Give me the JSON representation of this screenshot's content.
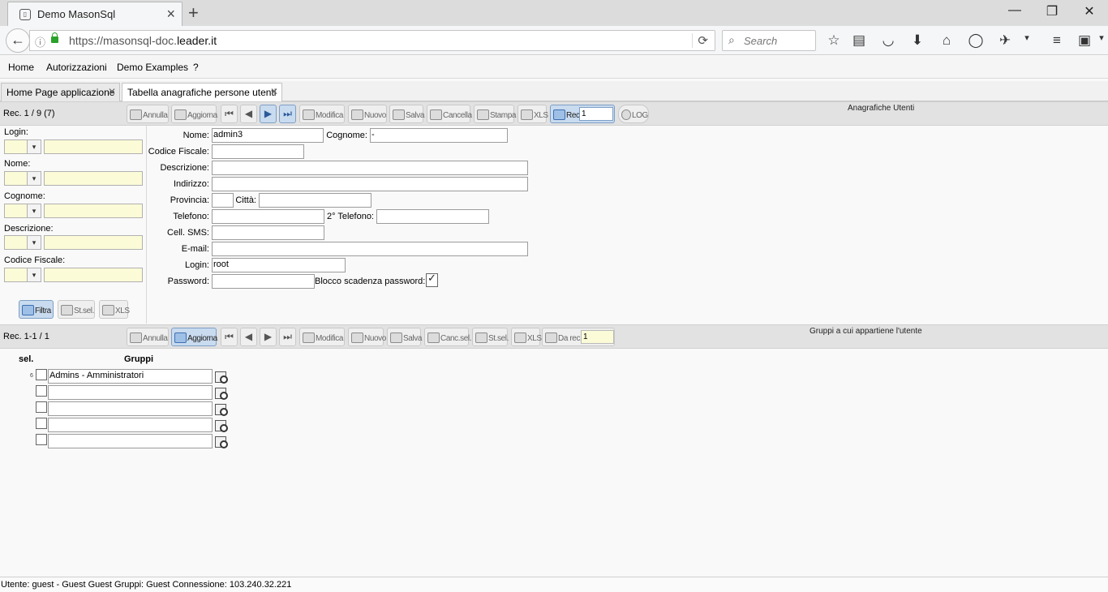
{
  "browser": {
    "tab_title": "Demo MasonSql",
    "favicon": "app-favicon",
    "close_icon": "close-icon",
    "new_tab_glyph": "+",
    "url_plain": "https://masonsql-doc.",
    "url_domain": "leader.it",
    "search_placeholder": "Search",
    "window_controls": [
      "minimize-icon",
      "restore-icon",
      "close-icon"
    ]
  },
  "menu": {
    "items": [
      "Home",
      "Autorizzazioni",
      "Demo Examples",
      "?"
    ]
  },
  "app_tabs": [
    {
      "label": "Home Page applicazione",
      "active": false
    },
    {
      "label": "Tabella anagrafiche persone utenti",
      "active": true
    }
  ],
  "toolbar1": {
    "record_info": "Rec. 1 / 9 (7)",
    "buttons": {
      "annulla": "Annulla",
      "aggiorna": "Aggiorna",
      "modifica": "Modifica",
      "nuovo": "Nuovo",
      "salva": "Salva",
      "cancella": "Cancella",
      "stampa": "Stampa",
      "xls": "XLS",
      "rec": "Rec.",
      "log": "LOG"
    },
    "rec_value": "1",
    "title": "Anagrafiche Utenti"
  },
  "filter": {
    "fields": [
      "Login:",
      "Nome:",
      "Cognome:",
      "Descrizione:",
      "Codice Fiscale:"
    ],
    "buttons": {
      "filtra": "Filtra",
      "stsel": "St.sel.",
      "xls": "XLS"
    }
  },
  "form": {
    "labels": {
      "nome": "Nome:",
      "cognome": "Cognome:",
      "codice_fiscale": "Codice Fiscale:",
      "descrizione": "Descrizione:",
      "indirizzo": "Indirizzo:",
      "provincia": "Provincia:",
      "citta": "Città:",
      "telefono": "Telefono:",
      "telefono2": "2° Telefono:",
      "cell_sms": "Cell. SMS:",
      "email": "E-mail:",
      "login": "Login:",
      "password": "Password:",
      "blocco": "Blocco scadenza password:"
    },
    "values": {
      "nome": "admin3",
      "cognome": "-",
      "codice_fiscale": "",
      "descrizione": "",
      "indirizzo": "",
      "provincia": "",
      "citta": "",
      "telefono": "",
      "telefono2": "",
      "cell_sms": "",
      "email": "",
      "login": "root",
      "password": "",
      "blocco_checked": true
    }
  },
  "toolbar2": {
    "record_info": "Rec. 1-1 / 1",
    "buttons": {
      "annulla": "Annulla",
      "aggiorna": "Aggiorna",
      "modifica": "Modifica",
      "nuovo": "Nuovo",
      "salva": "Salva",
      "cancsel": "Canc.sel.",
      "stsel": "St.sel.",
      "xls": "XLS",
      "darec": "Da rec."
    },
    "rec_value": "1",
    "title": "Gruppi a cui appartiene l'utente"
  },
  "groups": {
    "headers": {
      "sel": "sel.",
      "gruppi": "Gruppi"
    },
    "rows": [
      {
        "index": "6",
        "value": "Admins - Amministratori"
      },
      {
        "index": "",
        "value": ""
      },
      {
        "index": "",
        "value": ""
      },
      {
        "index": "",
        "value": ""
      },
      {
        "index": "",
        "value": ""
      }
    ]
  },
  "status": "Utente: guest - Guest Guest Gruppi: Guest Connessione: 103.240.32.221"
}
